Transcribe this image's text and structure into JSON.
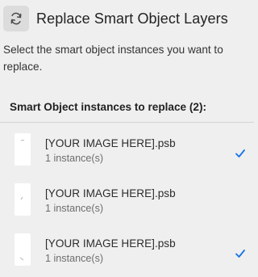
{
  "header": {
    "title": "Replace Smart Object Layers",
    "refresh_icon": "refresh-icon"
  },
  "description": "Select the smart object instances you want to replace.",
  "section": {
    "title": "Smart Object instances to replace (2):"
  },
  "items": [
    {
      "name": "[YOUR IMAGE HERE].psb",
      "count": "1 instance(s)",
      "selected": true
    },
    {
      "name": "[YOUR IMAGE HERE].psb",
      "count": "1 instance(s)",
      "selected": false
    },
    {
      "name": "[YOUR IMAGE HERE].psb",
      "count": "1 instance(s)",
      "selected": true
    }
  ],
  "colors": {
    "background": "#efefef",
    "accent_check": "#1473e6",
    "icon_button_bg": "#dcdcdc"
  }
}
